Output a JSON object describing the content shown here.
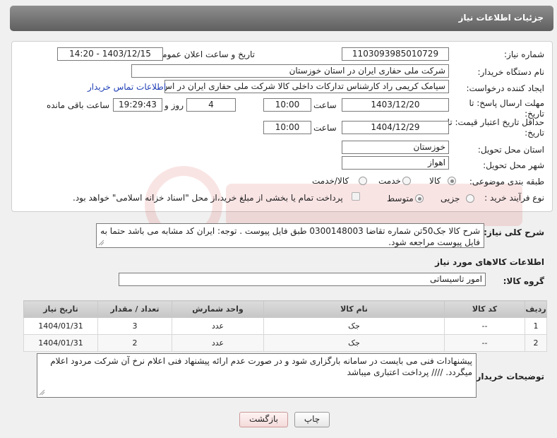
{
  "header": {
    "title": "جزئیات اطلاعات نیاز"
  },
  "form": {
    "need_number_label": "شماره نیاز:",
    "need_number": "1103093985010729",
    "announce_label": "تاریخ و ساعت اعلان عمومی:",
    "announce_value": "1403/12/15 - 14:20",
    "buyer_org_label": "نام دستگاه خریدار:",
    "buyer_org": "شرکت ملی حفاری ایران در استان خوزستان",
    "creator_label": "ایجاد کننده درخواست:",
    "creator": "سیامک کریمی راد کارشناس تدارکات داخلی کالا شرکت ملی حفاری ایران در اس",
    "contact_link": "اطلاعات تماس خریدار",
    "deadline_label_1": "مهلت ارسال پاسخ: تا",
    "deadline_label_2": "تاریخ:",
    "deadline_date": "1403/12/20",
    "time_label": "ساعت",
    "deadline_time": "10:00",
    "days_value": "4",
    "days_label": "روز و",
    "remaining_time": "19:29:43",
    "remaining_label": "ساعت باقی مانده",
    "validity_label_1": "حداقل تاریخ اعتبار قیمت: تا",
    "validity_label_2": "تاریخ:",
    "validity_date": "1404/12/29",
    "validity_time": "10:00",
    "province_label": "استان محل تحویل:",
    "province": "خوزستان",
    "city_label": "شهر محل تحویل:",
    "city": "اهواز",
    "category_label": "طبقه بندی موضوعی:",
    "category_options": [
      "کالا",
      "خدمت",
      "کالا/خدمت"
    ],
    "process_label": "نوع فرآیند خرید :",
    "process_options": [
      "جزیی",
      "متوسط"
    ],
    "payment_note": "پرداخت تمام یا بخشی از مبلغ خرید،از محل \"اسناد خزانه اسلامی\" خواهد بود."
  },
  "description": {
    "label": "شرح کلی نیاز:",
    "text": "شرح کالا جک50تن شماره تقاضا 0300148003  طبق فایل پیوست . توجه: ایران کد مشابه می باشد حتما به فایل پیوست مراجعه شود."
  },
  "goods": {
    "section_title": "اطلاعات کالاهای مورد نیاز",
    "group_label": "گروه کالا:",
    "group_value": "امور تاسیساتی",
    "columns": [
      "ردیف",
      "کد کالا",
      "نام کالا",
      "واحد شمارش",
      "تعداد / مقدار",
      "تاریخ نیاز"
    ],
    "rows": [
      [
        "1",
        "--",
        "جک",
        "عدد",
        "3",
        "1404/01/31"
      ],
      [
        "2",
        "--",
        "جک",
        "عدد",
        "2",
        "1404/01/31"
      ]
    ]
  },
  "buyer_notes": {
    "label": "توضیحات خریدار:",
    "text": "پیشنهادات فنی می بایست در سامانه بارگزاری شود و در صورت عدم ارائه پیشنهاد فنی اعلام نرخ آن شرکت مردود اعلام میگردد.  //// پرداخت اعتباری میباشد"
  },
  "buttons": {
    "print": "چاپ",
    "back": "بازگشت"
  },
  "colors": {
    "header": "#6f6f6f",
    "link": "#1f3fb5"
  }
}
